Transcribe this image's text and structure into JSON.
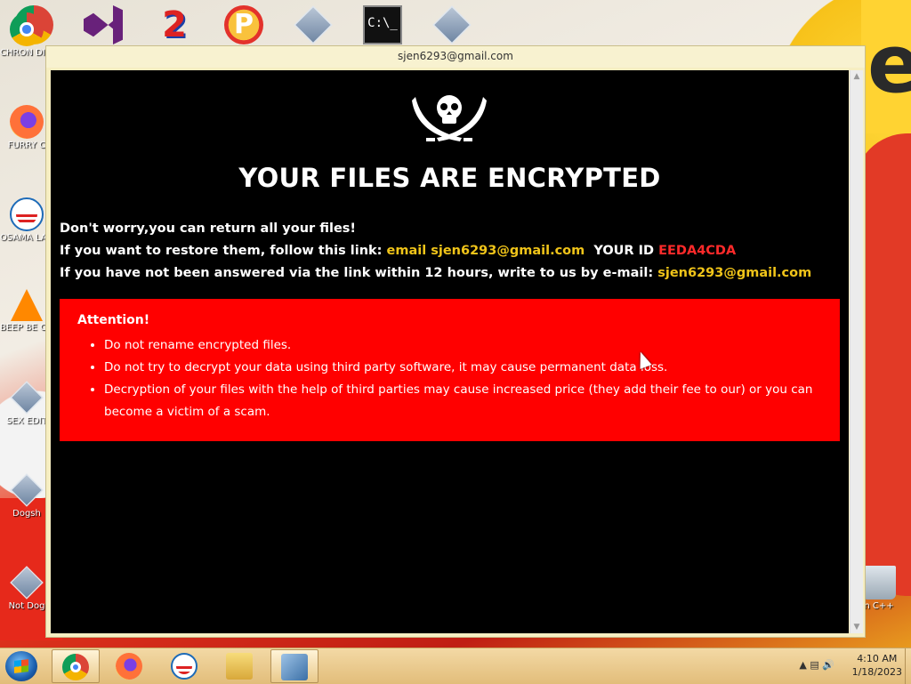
{
  "window": {
    "title": "sjen6293@gmail.com"
  },
  "ransom": {
    "headline": "YOUR FILES ARE ENCRYPTED",
    "line1": "Don't worry,you can return all your files!",
    "line2_prefix": "If you want to restore them, follow this link: ",
    "line2_link": "email sjen6293@gmail.com",
    "line2_id_label": "  YOUR ID ",
    "line2_id_value": "EEDA4CDA",
    "line3_prefix": "If you have not been answered via the link within 12 hours, write to us by e-mail: ",
    "line3_email": "sjen6293@gmail.com",
    "attention_title": "Attention!",
    "attention_items": [
      "Do not rename encrypted files.",
      "Do not try to decrypt your data using third party software, it may cause permanent data loss.",
      "Decryption of your files with the help of third parties may cause increased price (they add their fee to our) or you can become a victim of a scam."
    ]
  },
  "desktop": {
    "left_icons": [
      {
        "label": "CHRON DISEA",
        "icon": "chrome-icon"
      },
      {
        "label": "FURRY C",
        "icon": "firefox-icon"
      },
      {
        "label": "OSAMA LADEN B",
        "icon": "obama-icon"
      },
      {
        "label": "BEEP BE CAR",
        "icon": "vlc-icon"
      },
      {
        "label": "SEX EDIT",
        "icon": "file-icon"
      },
      {
        "label": "Dogsh",
        "icon": "file-icon"
      },
      {
        "label": "Not Dog",
        "icon": "file-icon"
      }
    ],
    "right_icon_label": "n C++",
    "top_icons": [
      "visual-studio-icon",
      "two-icon",
      "p-icon",
      "file-icon",
      "cmd-icon",
      "file-icon"
    ],
    "cmd_text": "C:\\_"
  },
  "taskbar": {
    "time": "4:10 AM",
    "date": "1/18/2023",
    "tray_arrow": "▲"
  },
  "colors": {
    "ransom_bg": "#000000",
    "attention_bg": "#ff0000",
    "email_color": "#f0c419",
    "id_color": "#ff2a2a"
  }
}
